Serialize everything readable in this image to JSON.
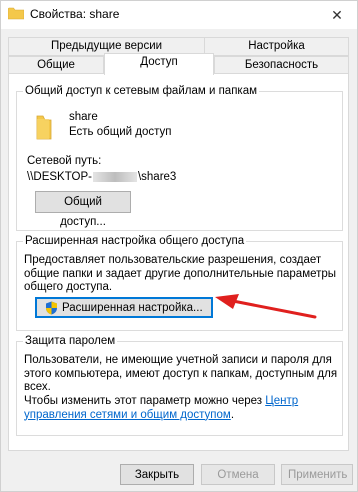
{
  "window": {
    "title": "Свойства: share",
    "close_glyph": "✕"
  },
  "tabs": {
    "row1": [
      "Предыдущие версии",
      "Настройка"
    ],
    "row2": [
      "Общие",
      "Доступ",
      "Безопасность"
    ],
    "active": "Доступ"
  },
  "network_share": {
    "group_title": "Общий доступ к сетевым файлам и папкам",
    "folder_name": "share",
    "share_status": "Есть общий доступ",
    "path_label": "Сетевой путь:",
    "path_value": "\\\\DESKTOP-",
    "path_suffix": "\\share3",
    "button": "Общий доступ..."
  },
  "advanced": {
    "group_title": "Расширенная настройка общего доступа",
    "description": "Предоставляет пользовательские разрешения, создает общие папки и задает другие дополнительные параметры общего доступа.",
    "button": "Расширенная настройка..."
  },
  "password": {
    "group_title": "Защита паролем",
    "description": "Пользователи, не имеющие учетной записи и пароля для этого компьютера, имеют доступ к папкам, доступным для всех.",
    "change_text": "Чтобы изменить этот параметр можно через",
    "link_text": "Центр управления сетями и общим доступом",
    "link_suffix": "."
  },
  "footer": {
    "close": "Закрыть",
    "cancel": "Отмена",
    "apply": "Применить"
  },
  "colors": {
    "accent": "#0078d7",
    "arrow": "#e0201e",
    "folder": "#f4c84a",
    "link": "#0066cc"
  }
}
